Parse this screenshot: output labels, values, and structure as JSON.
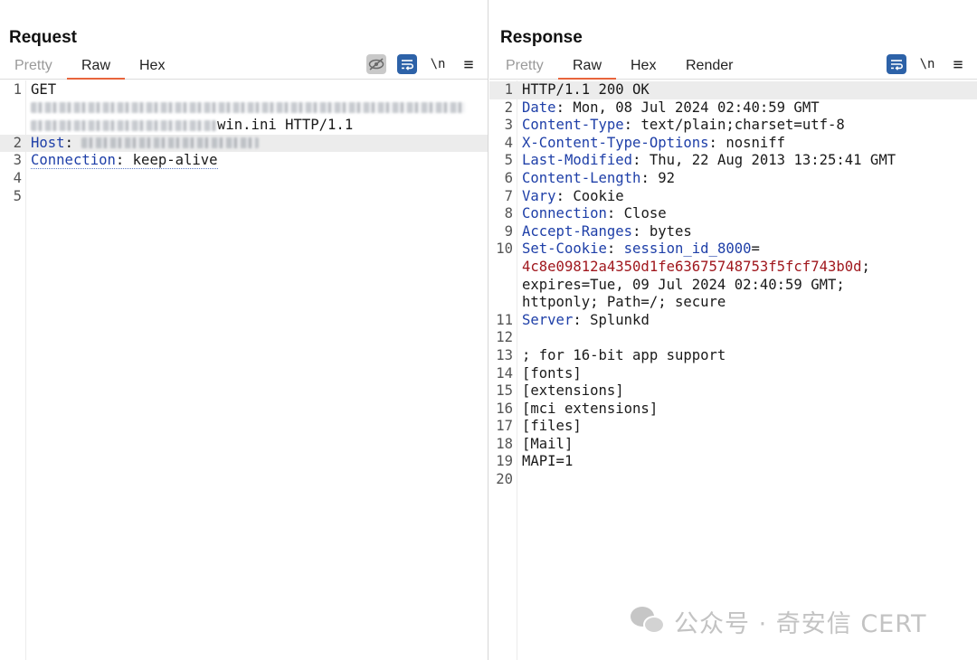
{
  "layout_toggle": {
    "icons": [
      "split-columns-icon",
      "split-rows-icon",
      "single-pane-icon"
    ]
  },
  "request": {
    "title": "Request",
    "tabs": [
      {
        "label": "Pretty"
      },
      {
        "label": "Raw"
      },
      {
        "label": "Hex"
      }
    ],
    "active_tab": "Raw",
    "lines": [
      {
        "num": "1",
        "text": "GET"
      },
      {
        "num": "",
        "text": "win.ini HTTP/1.1"
      },
      {
        "num": "2",
        "key": "Host",
        "text": ": "
      },
      {
        "num": "3",
        "key": "Connection",
        "text": ": keep-alive"
      },
      {
        "num": "4",
        "text": ""
      },
      {
        "num": "5",
        "text": ""
      }
    ],
    "newline_toggle": "\\n",
    "menu": "≡"
  },
  "response": {
    "title": "Response",
    "tabs": [
      {
        "label": "Pretty"
      },
      {
        "label": "Raw"
      },
      {
        "label": "Hex"
      },
      {
        "label": "Render"
      }
    ],
    "active_tab": "Raw",
    "newline_toggle": "\\n",
    "menu": "≡",
    "lines": [
      {
        "num": "1",
        "text": "HTTP/1.1 200 OK"
      },
      {
        "num": "2",
        "key": "Date",
        "text": ": Mon, 08 Jul 2024 02:40:59 GMT"
      },
      {
        "num": "3",
        "key": "Content-Type",
        "text": ": text/plain;charset=utf-8"
      },
      {
        "num": "4",
        "key": "X-Content-Type-Options",
        "text": ": nosniff"
      },
      {
        "num": "5",
        "key": "Last-Modified",
        "text": ": Thu, 22 Aug 2013 13:25:41 GMT"
      },
      {
        "num": "6",
        "key": "Content-Length",
        "text": ": 92"
      },
      {
        "num": "7",
        "key": "Vary",
        "text": ": Cookie"
      },
      {
        "num": "8",
        "key": "Connection",
        "text": ": Close"
      },
      {
        "num": "9",
        "key": "Accept-Ranges",
        "text": ": bytes"
      },
      {
        "num": "10",
        "key": "Set-Cookie",
        "text": ": ",
        "cookie_name": "session_id_8000",
        "cookie_eq": "="
      },
      {
        "num": "",
        "cookie_value": "4c8e09812a4350d1fe63675748753f5fcf743b0d",
        "text": ";"
      },
      {
        "num": "",
        "text": "expires=Tue, 09 Jul 2024 02:40:59 GMT;"
      },
      {
        "num": "",
        "text": "httponly; Path=/; secure"
      },
      {
        "num": "11",
        "key": "Server",
        "text": ": Splunkd"
      },
      {
        "num": "12",
        "text": ""
      },
      {
        "num": "13",
        "text": "; for 16-bit app support"
      },
      {
        "num": "14",
        "text": "[fonts]"
      },
      {
        "num": "15",
        "text": "[extensions]"
      },
      {
        "num": "16",
        "text": "[mci extensions]"
      },
      {
        "num": "17",
        "text": "[files]"
      },
      {
        "num": "18",
        "text": "[Mail]"
      },
      {
        "num": "19",
        "text": "MAPI=1"
      },
      {
        "num": "20",
        "text": ""
      }
    ]
  },
  "watermark": {
    "text": "公众号 · 奇安信 CERT"
  },
  "colors": {
    "accent_tab": "#e8643c",
    "header_key": "#1e3fa8",
    "cookie_value": "#a0181e",
    "toggle_blue": "#2d62a8"
  }
}
